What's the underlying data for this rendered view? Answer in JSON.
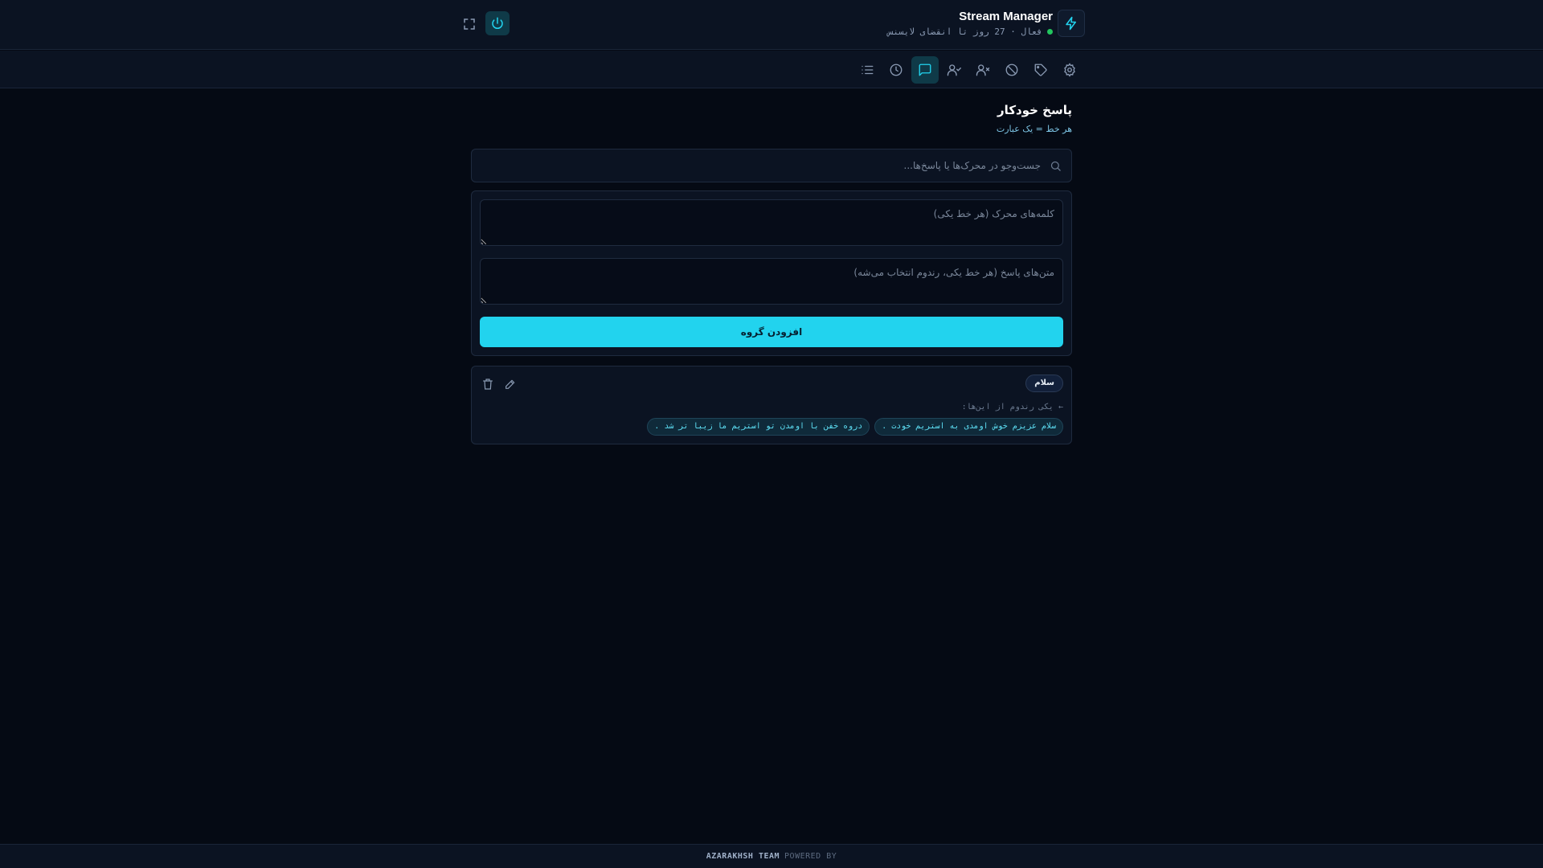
{
  "header": {
    "app_title": "Stream Manager",
    "license_status": "فعال · 27 روز تا انقضای لایسنس",
    "brand_icon": "bolt-icon",
    "power_icon": "power-icon",
    "fullscreen_icon": "fullscreen-icon",
    "status_color": "#22c55e",
    "accent_color": "#22d3ee"
  },
  "nav": {
    "items": [
      {
        "icon": "gear-icon",
        "active": false
      },
      {
        "icon": "tag-icon",
        "active": false
      },
      {
        "icon": "ban-icon",
        "active": false
      },
      {
        "icon": "user-x-icon",
        "active": false
      },
      {
        "icon": "user-check-icon",
        "active": false
      },
      {
        "icon": "message-square-icon",
        "active": true
      },
      {
        "icon": "clock-icon",
        "active": false
      },
      {
        "icon": "list-icon",
        "active": false
      }
    ]
  },
  "page": {
    "title": "پاسخ خودکار",
    "subtitle": "هر خط = یک عبارت"
  },
  "search": {
    "placeholder": "جست‌وجو در محرک‌ها یا پاسخ‌ها...",
    "value": ""
  },
  "form": {
    "triggers_placeholder": "کلمه‌های محرک (هر خط یکی)",
    "responses_placeholder": "متن‌های پاسخ (هر خط یکی، رندوم انتخاب می‌شه)",
    "add_label": "افزودن گروه"
  },
  "group": {
    "trigger": "سلام",
    "random_label": "← یکی رندوم از این‌ها:",
    "responses": [
      "سلام عزیزم خوش اومدی به استریم خودت .",
      "دروه خفن با اومدن تو استریم ما زیبا تر شد ."
    ]
  },
  "footer": {
    "team": "AZARAKHSH TEAM",
    "powered_by": "POWERED BY"
  }
}
